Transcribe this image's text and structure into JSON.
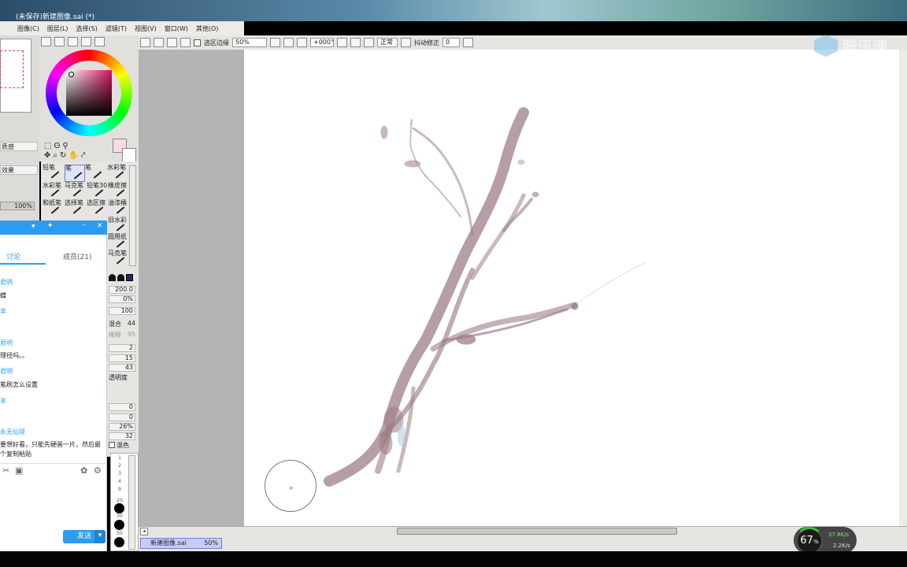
{
  "window": {
    "title": "(未保存)新建图像.sai (*)"
  },
  "menu": [
    {
      "label": "图像(C)"
    },
    {
      "label": "图层(L)"
    },
    {
      "label": "选择(S)"
    },
    {
      "label": "滤镜(T)"
    },
    {
      "label": "视图(V)"
    },
    {
      "label": "窗口(W)"
    },
    {
      "label": "其他(O)"
    }
  ],
  "toolbar": {
    "selection_edge": "选区边缘",
    "zoom": "50%",
    "angle": "+000°",
    "blend": "正常",
    "stabilizer_label": "抖动修正",
    "stabilizer_value": "0"
  },
  "tools": [
    {
      "name": "铅笔"
    },
    {
      "name": "笔"
    },
    {
      "name": "笔"
    },
    {
      "name": "水彩笔"
    },
    {
      "name": "水彩笔"
    },
    {
      "name": "马克笔"
    },
    {
      "name": "铅笔30"
    },
    {
      "name": "橡皮擦"
    },
    {
      "name": "和纸笔"
    },
    {
      "name": "选择笔"
    },
    {
      "name": "选区擦"
    },
    {
      "name": "油漆桶"
    },
    {
      "name": "旧水彩"
    },
    {
      "name": "圆用纸"
    },
    {
      "name": "马克笔"
    }
  ],
  "left_panel": {
    "texture_label": "质感",
    "effect_label": "效果",
    "opacity": "100%"
  },
  "brush_params": {
    "size": "200.0",
    "min_size": "0%",
    "density": "100",
    "blending_label": "混合",
    "blending_value": "44",
    "dilution_label": "稀释",
    "dilution_value": "95",
    "v1": "2",
    "v2": "15",
    "v3": "43",
    "keep_opacity": "透明度",
    "v4": "0",
    "v5": "0",
    "v6": "26%",
    "v7": "32",
    "mix_label": "混色"
  },
  "brush_sizes": [
    "1",
    "2",
    "3",
    "4",
    "9",
    "20",
    "30",
    "50"
  ],
  "chat": {
    "tab_discuss": "讨论",
    "tab_members": "成员(21)",
    "messages": [
      {
        "user": "君明",
        "text": "蝶"
      },
      {
        "user": "羊",
        "text": ""
      },
      {
        "user": "君明",
        "text": "理径吗。。"
      },
      {
        "user": "君明",
        "text": "笔刷怎么设置"
      },
      {
        "user": "羊",
        "text": ""
      },
      {
        "user": "永无仙境",
        "text": "要想好看，只能先硬画一片，然后最"
      },
      {
        "user": "",
        "text": "个复制粘贴"
      }
    ],
    "send_label": "发送"
  },
  "status": {
    "file_name": "新建图像.sai",
    "file_zoom": "50%"
  },
  "overlay": {
    "watermark": "腾讯课",
    "cpu_percent": "67",
    "upload": "37.8K/s",
    "download": "2.2K/s"
  },
  "colors": {
    "accent": "#2c9cf0",
    "paint": "#9c7f86",
    "file_tab": "#c4cdf6"
  }
}
